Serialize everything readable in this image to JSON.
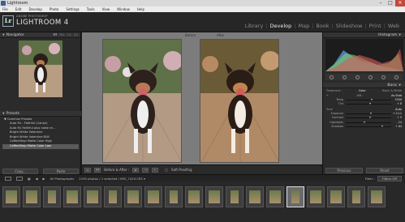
{
  "window": {
    "title": "Lightroom",
    "controls": [
      "–",
      "□",
      "✕"
    ]
  },
  "menu": [
    "File",
    "Edit",
    "Develop",
    "Photo",
    "Settings",
    "Tools",
    "View",
    "Window",
    "Help"
  ],
  "identity": {
    "logo": "Lr",
    "small": "ADOBE PHOTOSHOP",
    "big": "LIGHTROOM 4"
  },
  "modules": [
    {
      "label": "Library",
      "active": false
    },
    {
      "label": "Develop",
      "active": true
    },
    {
      "label": "Map",
      "active": false
    },
    {
      "label": "Book",
      "active": false
    },
    {
      "label": "Slideshow",
      "active": false
    },
    {
      "label": "Print",
      "active": false
    },
    {
      "label": "Web",
      "active": false
    }
  ],
  "left_panel": {
    "navigator_label": "Navigator",
    "navigator_zoom": [
      "FIT",
      "FILL",
      "1:1",
      "3:1"
    ],
    "presets_label": "Presets",
    "preset_folder": "Common Presets",
    "presets": [
      "Auto Fix - Faithful (Canon)",
      "Auto Fix Faithful plus noise re...",
      "Bright White Valentine",
      "Bright White Valentine B/W",
      "CoffeeShop Matte Color High",
      "CoffeeShop Matte Color Low"
    ],
    "selected_preset_index": 5,
    "copy_label": "Copy...",
    "paste_label": "Paste"
  },
  "center": {
    "before_label": "Before",
    "after_label": "After"
  },
  "toolbar": {
    "view_btn": "YY",
    "before_after_label": "Before & After :",
    "soft_proofing_label": "Soft Proofing"
  },
  "right_panel": {
    "histogram_label": "Histogram",
    "basic_label": "Basic",
    "treatment_label": "Treatment :",
    "treatment_options": [
      "Color",
      "Black & White"
    ],
    "wb_label": "WB :",
    "wb_value": "As Shot",
    "tone_label": "Tone",
    "tone_auto": "Auto",
    "sliders": [
      {
        "label": "Temp",
        "value": "5500",
        "pos": 0.55
      },
      {
        "label": "Tint",
        "value": "+ 8",
        "pos": 0.52
      },
      {
        "label": "Exposure",
        "value": "+ 0.12",
        "pos": 0.53
      },
      {
        "label": "Contrast",
        "value": "+ 5",
        "pos": 0.52
      },
      {
        "label": "Highlights",
        "value": "- 24",
        "pos": 0.4
      },
      {
        "label": "Shadows",
        "value": "+ 64",
        "pos": 0.78
      }
    ],
    "previous_label": "Previous",
    "reset_label": "Reset"
  },
  "filmstrip_bar": {
    "source": "All Photographs",
    "count": "2193 photos / 1 selected / IMG_7429.CR2 ▾",
    "filter_label": "Filter :",
    "filter_value": "Filters Off"
  },
  "thumbs_count": 19,
  "selected_thumb": 14,
  "colors": {
    "accent": "#e8e8e8",
    "panel": "#2b2b2b",
    "background": "#7c7c7c"
  }
}
